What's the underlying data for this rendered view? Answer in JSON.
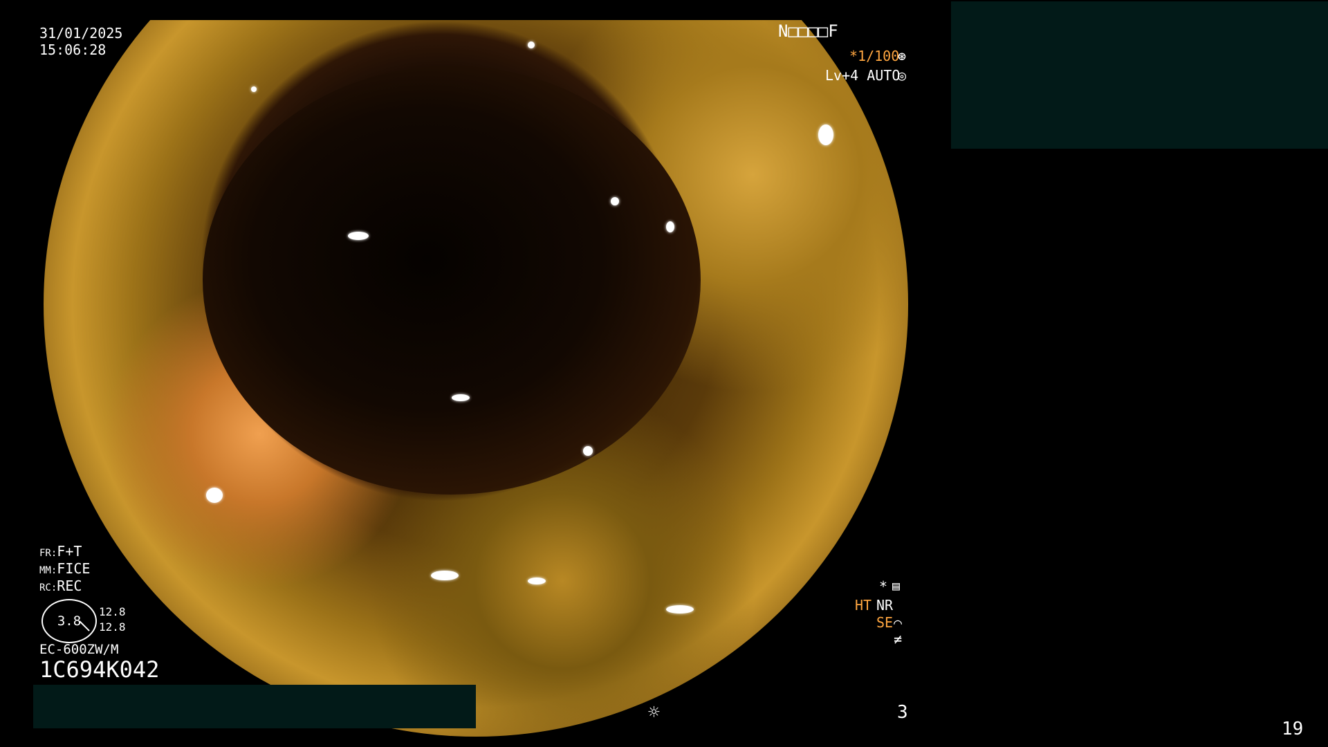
{
  "timestamp": {
    "date": "31/01/2025",
    "time": "15:06:28"
  },
  "top_right": {
    "id_code": "N□□□□F",
    "shutter": "*1/100",
    "shutter_icon": "aperture-icon",
    "level": "Lv+4 AUTO",
    "level_icon": "target-icon"
  },
  "bottom_left": {
    "fr_label": "FR:",
    "fr_value": "F+T",
    "mm_label": "MM:",
    "mm_value": "FICE",
    "rc_label": "RC:",
    "rc_value": "REC",
    "gauge_value": "3.8",
    "gauge_upper": "12.8",
    "gauge_lower": "12.8",
    "scope_model": "EC-600ZW/M",
    "serial": "1C694K042"
  },
  "bottom_right": {
    "star": "*",
    "ht": "HT",
    "nr": "NR",
    "se": "SE",
    "icons": [
      "settings-icon",
      "curve-icon",
      "not-equal-icon"
    ]
  },
  "footer": {
    "light_icon": "sun-icon",
    "counter": "3",
    "page_number": "19"
  },
  "colors": {
    "mask": "#021a18",
    "accent_orange": "#ffa640"
  }
}
